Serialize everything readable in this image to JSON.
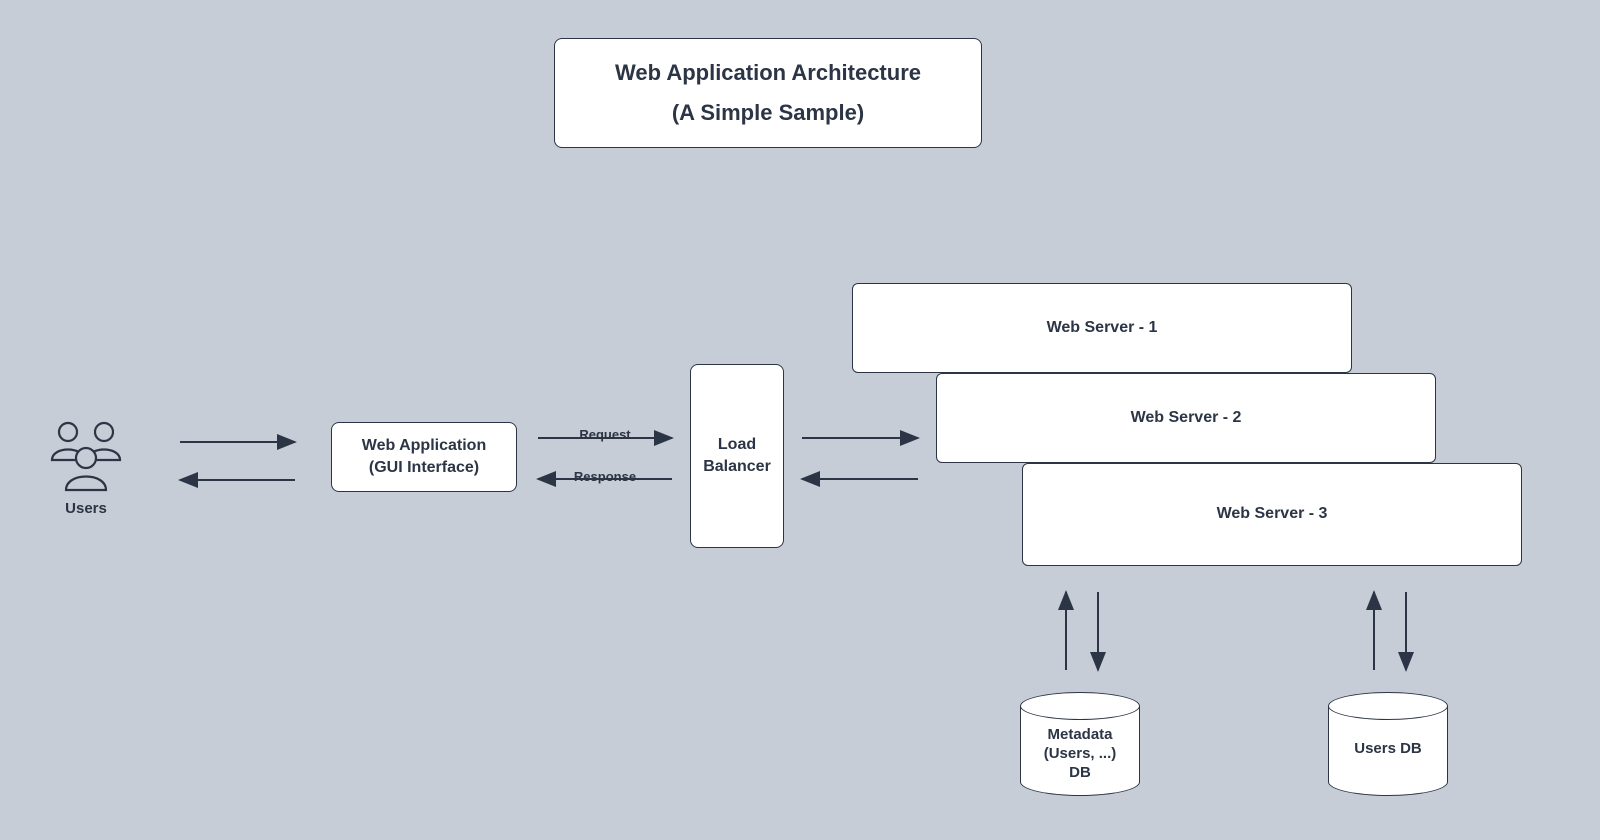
{
  "title": {
    "line1": "Web Application Architecture",
    "line2": "(A Simple Sample)"
  },
  "nodes": {
    "users_label": "Users",
    "web_app_line1": "Web Application",
    "web_app_line2": "(GUI Interface)",
    "load_balancer_line1": "Load",
    "load_balancer_line2": "Balancer",
    "server1": "Web Server - 1",
    "server2": "Web Server - 2",
    "server3": "Web Server - 3",
    "db_metadata_line1": "Metadata",
    "db_metadata_line2": "(Users, ...)",
    "db_metadata_line3": "DB",
    "db_users": "Users DB"
  },
  "edges": {
    "request_label": "Request",
    "response_label": "Response"
  }
}
